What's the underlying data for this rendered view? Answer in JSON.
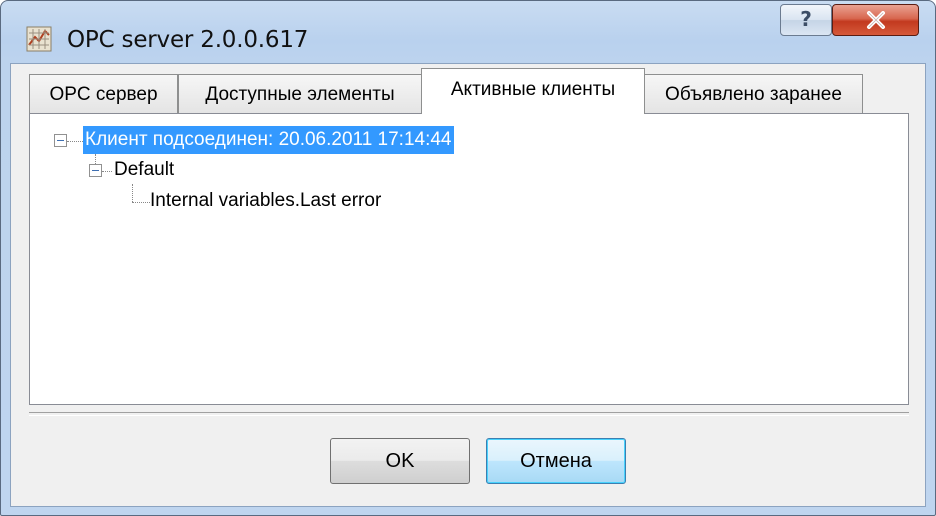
{
  "window": {
    "title": "OPC server 2.0.0.617",
    "icon": "app-icon",
    "help_label": "?",
    "close_icon": "close-x-icon"
  },
  "tabs": [
    {
      "label": "OPC сервер",
      "active": false
    },
    {
      "label": "Доступные элементы",
      "active": false
    },
    {
      "label": "Активные клиенты",
      "active": true
    },
    {
      "label": "Объявлено заранее",
      "active": false
    }
  ],
  "tree": {
    "root": {
      "label": "Клиент подсоединен: 20.06.2011 17:14:44",
      "expanded": true,
      "selected": true
    },
    "group": {
      "label": "Default",
      "expanded": true
    },
    "item": {
      "label": "Internal variables.Last error"
    }
  },
  "buttons": {
    "ok": "OK",
    "cancel": "Отмена"
  },
  "colors": {
    "selection": "#3399ff",
    "close_button": "#c7432a",
    "frame": "#bcd3ee"
  }
}
